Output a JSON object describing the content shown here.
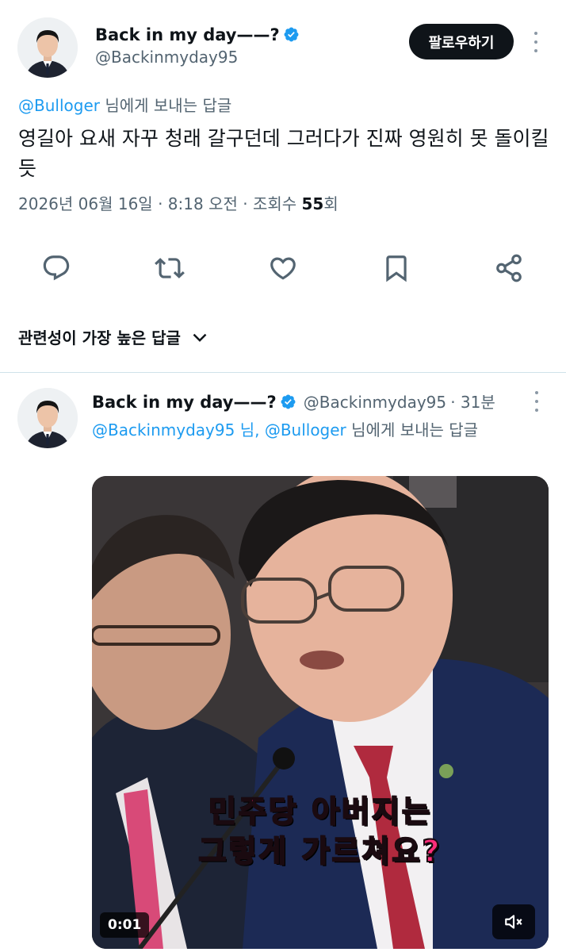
{
  "main_tweet": {
    "author": {
      "name": "Back in my day——?",
      "handle": "@Backinmyday95"
    },
    "follow_label": "팔로우하기",
    "reply_to": {
      "mention": "@Bulloger",
      "suffix": "님에게 보내는 답글"
    },
    "text": "영길아 요새 자꾸 청래 갈구던데 그러다가 진짜 영원히 못 돌이킬 듯",
    "meta": {
      "date": "2026년 06월 16일",
      "time": "8:18 오전",
      "views_label": "조회수",
      "views_count": "55",
      "views_suffix": "회"
    },
    "actions": [
      {
        "icon": "reply-icon"
      },
      {
        "icon": "retweet-icon"
      },
      {
        "icon": "like-icon"
      },
      {
        "icon": "bookmark-icon"
      },
      {
        "icon": "share-icon"
      }
    ]
  },
  "sort": {
    "label": "관련성이 가장 높은 답글"
  },
  "reply": {
    "author": {
      "name": "Back in my day——?",
      "handle": "@Backinmyday95",
      "age": "31분"
    },
    "reply_to": {
      "mentions": "@Backinmyday95 님, @Bulloger",
      "suffix": "님에게 보내는 답글"
    },
    "video": {
      "caption_line1": "민주당 아버지는",
      "caption_line2": "그렇게 가르쳐요?",
      "time": "0:01"
    }
  },
  "colors": {
    "accent": "#1d9bf0",
    "text": "#0f1419",
    "muted": "#536471",
    "caption": "#ff2d7a"
  }
}
